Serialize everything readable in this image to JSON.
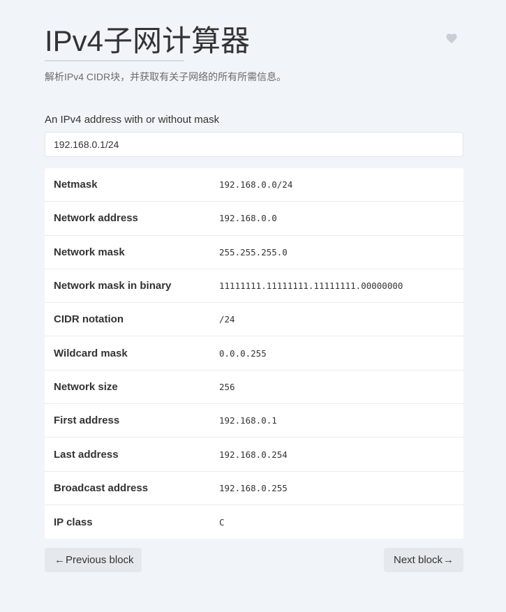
{
  "header": {
    "title": "IPv4子网计算器",
    "subtitle": "解析IPv4 CIDR块，并获取有关子网络的所有所需信息。",
    "favorite_icon": "heart-icon"
  },
  "input": {
    "label": "An IPv4 address with or without mask",
    "value": "192.168.0.1/24"
  },
  "results": [
    {
      "label": "Netmask",
      "value": "192.168.0.0/24"
    },
    {
      "label": "Network address",
      "value": "192.168.0.0"
    },
    {
      "label": "Network mask",
      "value": "255.255.255.0"
    },
    {
      "label": "Network mask in binary",
      "value": "11111111.11111111.11111111.00000000"
    },
    {
      "label": "CIDR notation",
      "value": "/24"
    },
    {
      "label": "Wildcard mask",
      "value": "0.0.0.255"
    },
    {
      "label": "Network size",
      "value": "256"
    },
    {
      "label": "First address",
      "value": "192.168.0.1"
    },
    {
      "label": "Last address",
      "value": "192.168.0.254"
    },
    {
      "label": "Broadcast address",
      "value": "192.168.0.255"
    },
    {
      "label": "IP class",
      "value": "C"
    }
  ],
  "buttons": {
    "prev_label": "Previous block",
    "next_label": "Next block"
  },
  "colors": {
    "background": "#f1f4f8",
    "card": "#ffffff",
    "button": "#e5e9ed",
    "text": "#333333",
    "icon": "#c9ced4"
  }
}
